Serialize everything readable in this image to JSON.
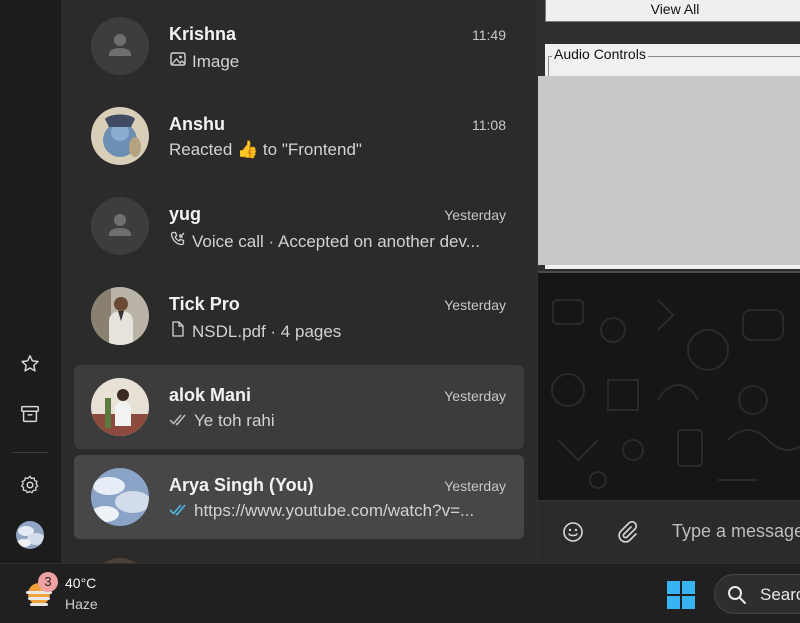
{
  "chats": [
    {
      "name": "Krishna",
      "time": "11:49",
      "preview": "Image",
      "preview_icon": "image-icon",
      "avatar": "default"
    },
    {
      "name": "Anshu",
      "time": "11:08",
      "preview": "Reacted 👍 to \"Frontend\"",
      "preview_icon": "",
      "avatar": "photo-shiva"
    },
    {
      "name": "yug",
      "time": "Yesterday",
      "preview": "Voice call · Accepted on another dev...",
      "preview_icon": "call-incoming-icon",
      "avatar": "default"
    },
    {
      "name": "Tick Pro",
      "time": "Yesterday",
      "preview": "NSDL.pdf · 4 pages",
      "preview_icon": "document-icon",
      "avatar": "photo-man-suit"
    },
    {
      "name": "alok Mani",
      "time": "Yesterday",
      "preview": "Ye toh rahi",
      "preview_icon": "double-check-gray-icon",
      "avatar": "photo-man-outdoor"
    },
    {
      "name": "Arya Singh (You)",
      "time": "Yesterday",
      "preview": "https://www.youtube.com/watch?v=...",
      "preview_icon": "double-check-blue-icon",
      "avatar": "photo-sky"
    }
  ],
  "panel": {
    "view_all_label": "View All",
    "audio_controls_legend": "Audio Controls"
  },
  "composer": {
    "placeholder": "Type a message"
  },
  "taskbar": {
    "weather_badge": "3",
    "weather_temp": "40°C",
    "weather_desc": "Haze",
    "search_label": "Search"
  },
  "colors": {
    "accent_blue_check": "#53bdeb",
    "sidebar_bg": "#1c1c1c",
    "chatlist_bg": "#2b2b2b",
    "selected_item_bg": "#474747",
    "hover_item_bg": "#3c3c3c"
  }
}
